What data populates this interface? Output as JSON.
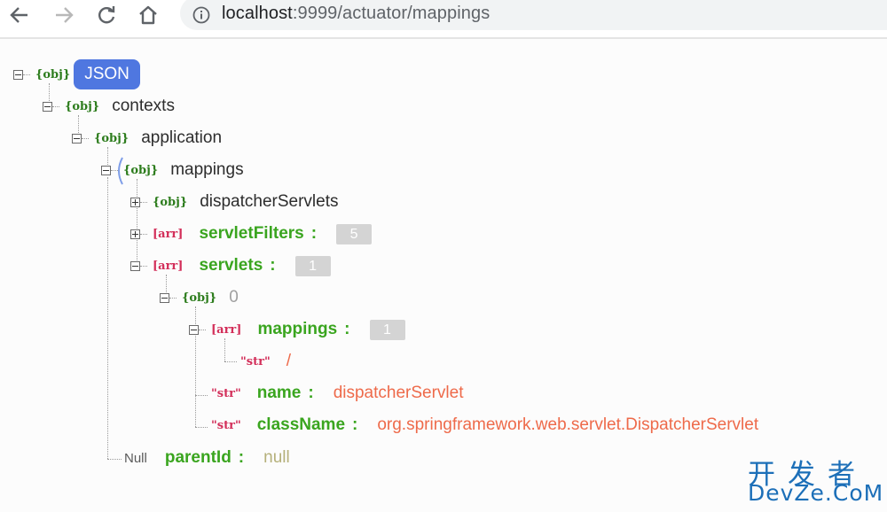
{
  "browser": {
    "url_host": "localhost",
    "url_rest": ":9999/actuator/mappings",
    "icons": [
      "back-arrow-icon",
      "forward-arrow-icon",
      "reload-icon",
      "home-icon",
      "info-icon"
    ]
  },
  "tree": {
    "root_type": "{obj}",
    "root_label": "JSON",
    "contexts": {
      "type": "{obj}",
      "key": "contexts"
    },
    "application": {
      "type": "{obj}",
      "key": "application"
    },
    "mappings": {
      "type": "{obj}",
      "key": "mappings"
    },
    "dispatcherServlets": {
      "type": "{obj}",
      "key": "dispatcherServlets"
    },
    "servletFilters": {
      "type": "[arr]",
      "key": "servletFilters",
      "colon": ":",
      "count": "5"
    },
    "servlets": {
      "type": "[arr]",
      "key": "servlets",
      "colon": ":",
      "count": "1"
    },
    "item0": {
      "type": "{obj}",
      "index": "0"
    },
    "item_mappings": {
      "type": "[arr]",
      "key": "mappings",
      "colon": ":",
      "count": "1"
    },
    "mapping_str": {
      "type": "\"str\"",
      "value": "/"
    },
    "name": {
      "type": "\"str\"",
      "key": "name",
      "colon": ":",
      "value": "dispatcherServlet"
    },
    "className": {
      "type": "\"str\"",
      "key": "className",
      "colon": ":",
      "value": "org.springframework.web.servlet.DispatcherServlet"
    },
    "parentId": {
      "type": "Null",
      "key": "parentId",
      "colon": ":",
      "value": "null"
    }
  },
  "watermark": {
    "line1": "开发者",
    "line2": "DevZe.CoM"
  },
  "colors": {
    "obj_tag": "#2e7d1e",
    "arr_tag": "#d32f5a",
    "key_green": "#3aa51f",
    "string_value": "#ee6a4a",
    "json_pill": "#4f77e0",
    "watermark": "#1c6fb8"
  }
}
